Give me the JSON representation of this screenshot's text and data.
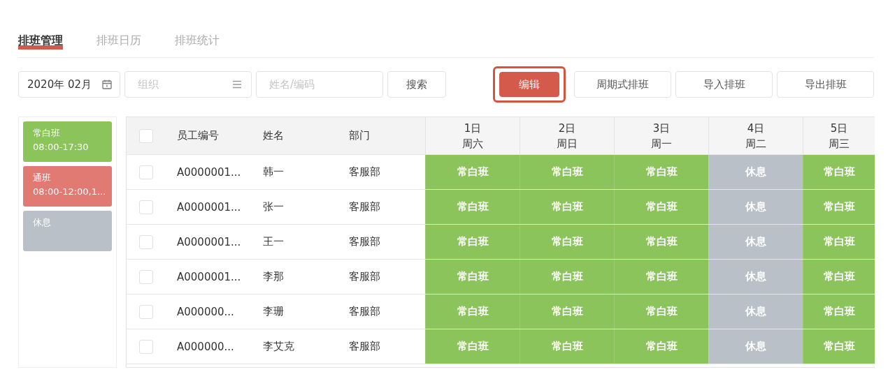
{
  "tabs": [
    {
      "label": "排班管理",
      "selected": true
    },
    {
      "label": "排班日历",
      "selected": false
    },
    {
      "label": "排班统计",
      "selected": false
    }
  ],
  "toolbar": {
    "month": "2020年 02月",
    "org": {
      "placeholder": "组织"
    },
    "search": {
      "placeholder": "姓名/编码"
    },
    "search_button": "搜索",
    "actions": [
      {
        "label": "编辑",
        "kind": "primary",
        "highlighted": true
      },
      {
        "label": "周期式排班",
        "kind": "default",
        "highlighted": false
      },
      {
        "label": "导入排班",
        "kind": "default",
        "highlighted": false
      },
      {
        "label": "导出排班",
        "kind": "default",
        "highlighted": false
      }
    ]
  },
  "legend": [
    {
      "name": "常白班",
      "time": "08:00-17:30",
      "kind": "day"
    },
    {
      "name": "通班",
      "time": "08:00-12:00,1...",
      "kind": "split"
    },
    {
      "name": "休息",
      "kind": "rest"
    }
  ],
  "table": {
    "header_checked": false,
    "columns": [
      "员工编号",
      "姓名",
      "部门"
    ],
    "days": [
      {
        "date": "1日",
        "weekday": "周六"
      },
      {
        "date": "2日",
        "weekday": "周日"
      },
      {
        "date": "3日",
        "weekday": "周一"
      },
      {
        "date": "4日",
        "weekday": "周二"
      },
      {
        "date": "5日",
        "weekday": "周三"
      }
    ],
    "rows": [
      {
        "checked": false,
        "id": "A0000001...",
        "name": "韩一",
        "dept": "客服部",
        "shifts": [
          {
            "label": "常白班",
            "kind": "day"
          },
          {
            "label": "常白班",
            "kind": "day"
          },
          {
            "label": "常白班",
            "kind": "day"
          },
          {
            "label": "休息",
            "kind": "rest"
          },
          {
            "label": "常白班",
            "kind": "day"
          }
        ]
      },
      {
        "checked": false,
        "id": "A0000001...",
        "name": "张一",
        "dept": "客服部",
        "shifts": [
          {
            "label": "常白班",
            "kind": "day"
          },
          {
            "label": "常白班",
            "kind": "day"
          },
          {
            "label": "常白班",
            "kind": "day"
          },
          {
            "label": "休息",
            "kind": "rest"
          },
          {
            "label": "常白班",
            "kind": "day"
          }
        ]
      },
      {
        "checked": false,
        "id": "A0000001...",
        "name": "王一",
        "dept": "客服部",
        "shifts": [
          {
            "label": "常白班",
            "kind": "day"
          },
          {
            "label": "常白班",
            "kind": "day"
          },
          {
            "label": "常白班",
            "kind": "day"
          },
          {
            "label": "休息",
            "kind": "rest"
          },
          {
            "label": "常白班",
            "kind": "day"
          }
        ]
      },
      {
        "checked": false,
        "id": "A0000001...",
        "name": "李那",
        "dept": "客服部",
        "shifts": [
          {
            "label": "常白班",
            "kind": "day"
          },
          {
            "label": "常白班",
            "kind": "day"
          },
          {
            "label": "常白班",
            "kind": "day"
          },
          {
            "label": "休息",
            "kind": "rest"
          },
          {
            "label": "常白班",
            "kind": "day"
          }
        ]
      },
      {
        "checked": false,
        "id": "A000000...",
        "name": "李珊",
        "dept": "客服部",
        "shifts": [
          {
            "label": "常白班",
            "kind": "day"
          },
          {
            "label": "常白班",
            "kind": "day"
          },
          {
            "label": "常白班",
            "kind": "day"
          },
          {
            "label": "休息",
            "kind": "rest"
          },
          {
            "label": "常白班",
            "kind": "day"
          }
        ]
      },
      {
        "checked": false,
        "id": "A000000...",
        "name": "李艾克",
        "dept": "客服部",
        "shifts": [
          {
            "label": "常白班",
            "kind": "day"
          },
          {
            "label": "常白班",
            "kind": "day"
          },
          {
            "label": "常白班",
            "kind": "day"
          },
          {
            "label": "休息",
            "kind": "rest"
          },
          {
            "label": "常白班",
            "kind": "day"
          }
        ]
      }
    ]
  }
}
